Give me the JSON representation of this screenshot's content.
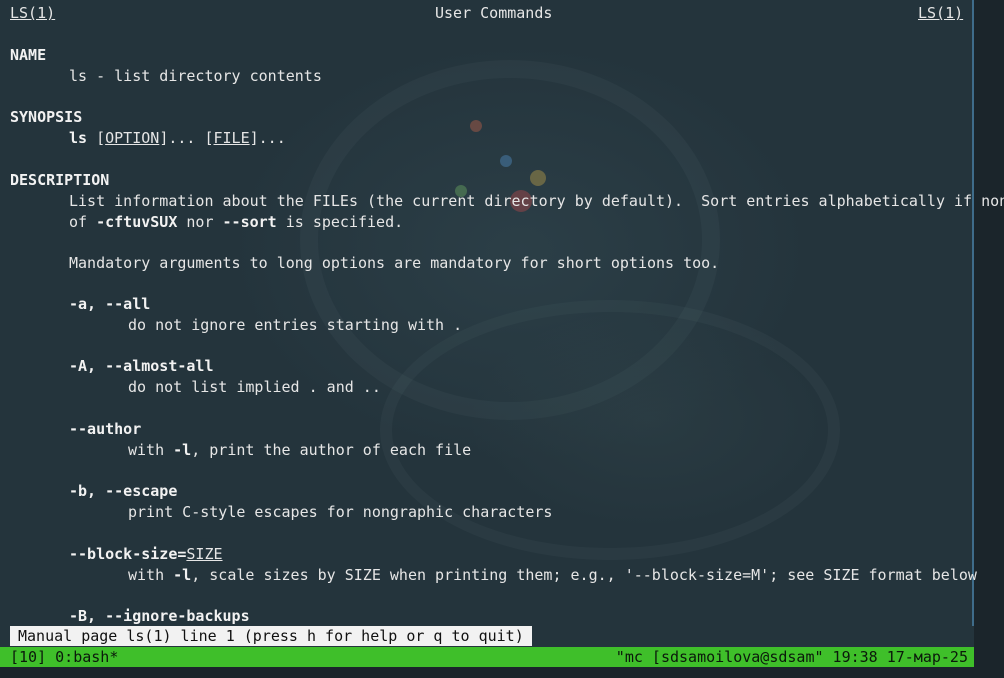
{
  "header": {
    "left": "LS(1)",
    "center": "User Commands",
    "right": "LS(1)"
  },
  "sections": {
    "name_heading": "NAME",
    "name_text": "ls - list directory contents",
    "synopsis_heading": "SYNOPSIS",
    "synopsis_cmd": "ls",
    "synopsis_option": "OPTION",
    "synopsis_file": "FILE",
    "description_heading": "DESCRIPTION",
    "desc_line1": "List information about the FILEs (the current directory by default).  Sort entries alphabetically if none",
    "desc_line2_prefix": "of",
    "desc_line2_flags": "-cftuvSUX",
    "desc_line2_mid": "nor",
    "desc_line2_sort": "--sort",
    "desc_line2_suffix": "is specified.",
    "mandatory": "Mandatory arguments to long options are mandatory for short options too."
  },
  "options": [
    {
      "flag": "-a, --all",
      "desc": "do not ignore entries starting with ."
    },
    {
      "flag": "-A, --almost-all",
      "desc": "do not list implied . and .."
    },
    {
      "flag": "--author",
      "desc_prefix": "with",
      "desc_flag": "-l",
      "desc_suffix": ", print the author of each file"
    },
    {
      "flag": "-b, --escape",
      "desc": "print C-style escapes for nongraphic characters"
    },
    {
      "flag": "--block-size=",
      "flag_arg": "SIZE",
      "desc_prefix": "with",
      "desc_flag": "-l",
      "desc_suffix": ", scale sizes by SIZE when printing them; e.g., '--block-size=M'; see SIZE format below"
    },
    {
      "flag": "-B, --ignore-backups"
    }
  ],
  "pager": {
    "status": "Manual page ls(1) line 1 (press h for help or q to quit)"
  },
  "tmux": {
    "left": "[10] 0:bash*",
    "right": "\"mc [sdsamoilova@sdsam\" 19:38 17-мар-25"
  },
  "colors": {
    "background": "#24343c",
    "text": "#e6e6e6",
    "tmux_bar": "#3fbf2a",
    "pane_border": "#3f6c8a"
  }
}
